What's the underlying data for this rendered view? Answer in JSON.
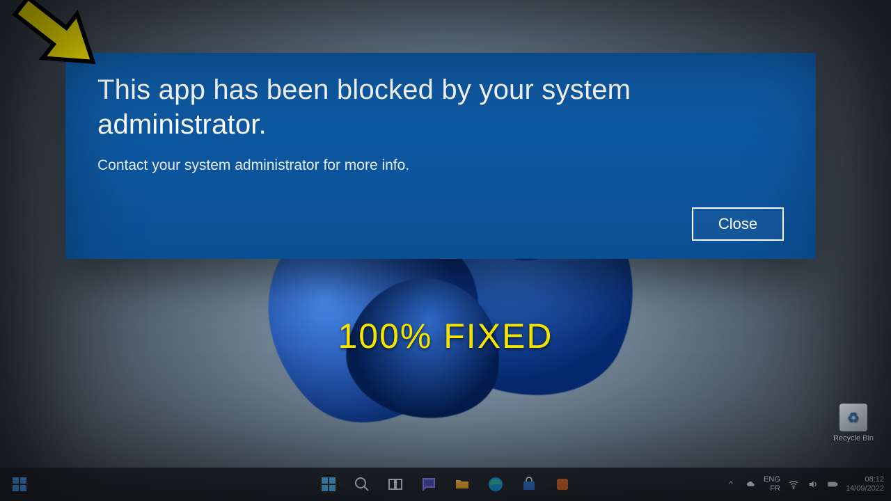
{
  "dialog": {
    "title": "This app has been blocked by your system administrator.",
    "subtitle": "Contact your system administrator for more info.",
    "close_label": "Close"
  },
  "overlay": {
    "caption": "100% FIXED"
  },
  "desktop": {
    "recycle_bin_label": "Recycle Bin"
  },
  "tray": {
    "chevron": "^",
    "language_top": "ENG",
    "language_bottom": "FR",
    "time": "08:12",
    "date": "14/09/2022"
  }
}
